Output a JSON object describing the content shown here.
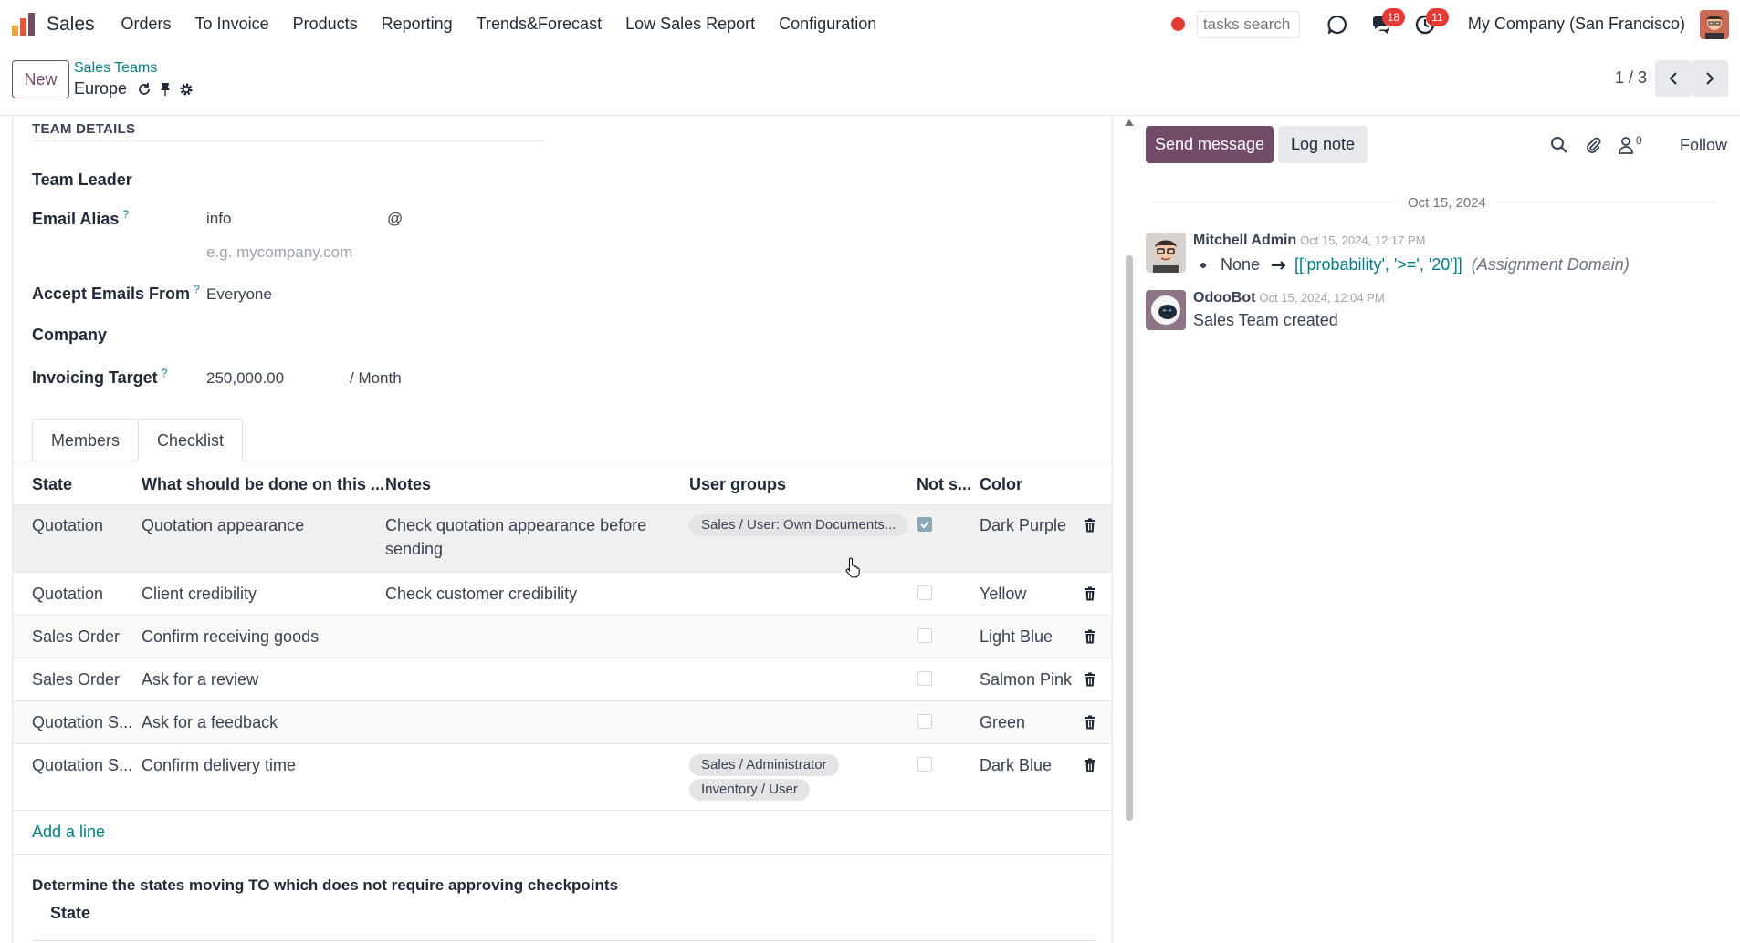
{
  "app": {
    "name": "Sales",
    "menu": [
      "Orders",
      "To Invoice",
      "Products",
      "Reporting",
      "Trends&Forecast",
      "Low Sales Report",
      "Configuration"
    ]
  },
  "topbar": {
    "search_placeholder": "tasks search",
    "messages_badge": "18",
    "activities_badge": "11",
    "company": "My Company (San Francisco)"
  },
  "control": {
    "new_label": "New",
    "breadcrumb": "Sales Teams",
    "record_name": "Europe",
    "pager": "1 / 3"
  },
  "form": {
    "section_title": "TEAM DETAILS",
    "fields": {
      "team_leader_label": "Team Leader",
      "email_alias_label": "Email Alias",
      "email_alias_value": "info",
      "email_at": "@",
      "email_domain_placeholder": "e.g. mycompany.com",
      "accept_from_label": "Accept Emails From",
      "accept_from_value": "Everyone",
      "company_label": "Company",
      "invoicing_label": "Invoicing Target",
      "invoicing_value": "250,000.00",
      "invoicing_unit": "/ Month",
      "help_mark": "?"
    },
    "tabs": [
      "Members",
      "Checklist"
    ],
    "active_tab": "Checklist"
  },
  "checklist": {
    "columns": [
      "State",
      "What should be done on this ...",
      "Notes",
      "User groups",
      "Not s...",
      "Color"
    ],
    "rows": [
      {
        "state": "Quotation",
        "task": "Quotation appearance",
        "notes_1": "Check quotation appearance before",
        "notes_2": "sending",
        "groups": [
          "Sales / User: Own Documents..."
        ],
        "checked": true,
        "color": "Dark Purple"
      },
      {
        "state": "Quotation",
        "task": "Client credibility",
        "notes_1": "Check customer credibility",
        "notes_2": "",
        "groups": [],
        "checked": false,
        "color": "Yellow"
      },
      {
        "state": "Sales Order",
        "task": "Confirm receiving goods",
        "notes_1": "",
        "notes_2": "",
        "groups": [],
        "checked": false,
        "color": "Light Blue"
      },
      {
        "state": "Sales Order",
        "task": "Ask for a review",
        "notes_1": "",
        "notes_2": "",
        "groups": [],
        "checked": false,
        "color": "Salmon Pink"
      },
      {
        "state": "Quotation S...",
        "task": "Ask for a feedback",
        "notes_1": "",
        "notes_2": "",
        "groups": [],
        "checked": false,
        "color": "Green"
      },
      {
        "state": "Quotation S...",
        "task": "Confirm delivery time",
        "notes_1": "",
        "notes_2": "",
        "groups": [
          "Sales / Administrator",
          "Inventory / User"
        ],
        "checked": false,
        "color": "Dark Blue"
      }
    ],
    "add_line": "Add a line"
  },
  "states": {
    "title": "Determine the states moving TO which does not require approving checkpoints",
    "column": "State"
  },
  "chatter": {
    "send_label": "Send message",
    "log_label": "Log note",
    "followers_count": "0",
    "follow_label": "Follow",
    "date_separator": "Oct 15, 2024",
    "messages": [
      {
        "author": "Mitchell Admin",
        "date": "Oct 15, 2024, 12:17 PM",
        "old_value": "None",
        "new_value": "[['probability', '>=', '20']]",
        "field": "(Assignment Domain)"
      },
      {
        "author": "OdooBot",
        "date": "Oct 15, 2024, 12:04 PM",
        "body": "Sales Team created"
      }
    ]
  },
  "colors": {
    "brand": "#714b67",
    "link": "#017e84",
    "badge": "#e53935"
  }
}
